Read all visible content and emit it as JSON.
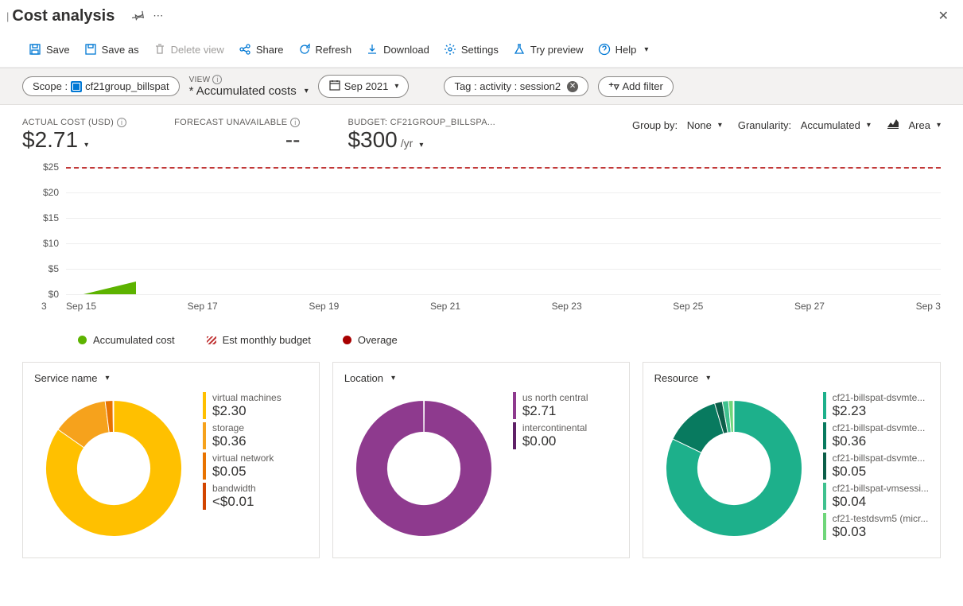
{
  "header": {
    "title": "Cost analysis"
  },
  "toolbar": {
    "save": "Save",
    "save_as": "Save as",
    "delete_view": "Delete view",
    "share": "Share",
    "refresh": "Refresh",
    "download": "Download",
    "settings": "Settings",
    "try_preview": "Try preview",
    "help": "Help"
  },
  "filters": {
    "scope_label": "Scope :",
    "scope_value": "cf21group_billspat",
    "view_label": "VIEW",
    "view_value": "* Accumulated costs",
    "date_value": "Sep 2021",
    "tag_label": "Tag : activity : session2",
    "add_filter": "Add filter"
  },
  "kpis": {
    "actual_label": "ACTUAL COST (USD)",
    "actual_value": "$2.71",
    "forecast_label": "FORECAST UNAVAILABLE",
    "forecast_value": "--",
    "budget_label": "BUDGET: CF21GROUP_BILLSPA...",
    "budget_value": "$300",
    "budget_suffix": "/yr"
  },
  "controls": {
    "group_by_label": "Group by:",
    "group_by_value": "None",
    "granularity_label": "Granularity:",
    "granularity_value": "Accumulated",
    "chart_type": "Area"
  },
  "chart_data": {
    "type": "area",
    "title": "",
    "ylabel": "",
    "xlabel": "",
    "y_ticks": [
      "$0",
      "$5",
      "$10",
      "$15",
      "$20",
      "$25"
    ],
    "ylim": [
      0,
      25
    ],
    "x_left": "3",
    "x_ticks": [
      "Sep 15",
      "Sep 17",
      "Sep 19",
      "Sep 21",
      "Sep 23",
      "Sep 25",
      "Sep 27",
      "Sep 3"
    ],
    "budget_line_value": 25,
    "series": [
      {
        "name": "Accumulated cost",
        "color": "#5db300",
        "x": [
          13,
          15
        ],
        "y": [
          0,
          2.7
        ]
      }
    ],
    "legend": [
      {
        "name": "Accumulated cost",
        "color": "#5db300",
        "shape": "circle"
      },
      {
        "name": "Est monthly budget",
        "color": "#c23939",
        "shape": "stripe"
      },
      {
        "name": "Overage",
        "color": "#a80000",
        "shape": "circle"
      }
    ]
  },
  "cards": {
    "service": {
      "title": "Service name",
      "chart_data": {
        "type": "pie",
        "series": [
          {
            "name": "virtual machines",
            "value": 2.3,
            "display": "$2.30",
            "color": "#ffc000"
          },
          {
            "name": "storage",
            "value": 0.36,
            "display": "$0.36",
            "color": "#f6a21c"
          },
          {
            "name": "virtual network",
            "value": 0.05,
            "display": "$0.05",
            "color": "#e87300"
          },
          {
            "name": "bandwidth",
            "value": 0.005,
            "display": "<$0.01",
            "color": "#d24500"
          }
        ]
      }
    },
    "location": {
      "title": "Location",
      "chart_data": {
        "type": "pie",
        "series": [
          {
            "name": "us north central",
            "value": 2.71,
            "display": "$2.71",
            "color": "#8e3a8e"
          },
          {
            "name": "intercontinental",
            "value": 0.001,
            "display": "$0.00",
            "color": "#5f2167"
          }
        ]
      }
    },
    "resource": {
      "title": "Resource",
      "chart_data": {
        "type": "pie",
        "series": [
          {
            "name": "cf21-billspat-dsvmte...",
            "value": 2.23,
            "display": "$2.23",
            "color": "#1db08b"
          },
          {
            "name": "cf21-billspat-dsvmte...",
            "value": 0.36,
            "display": "$0.36",
            "color": "#087a5f"
          },
          {
            "name": "cf21-billspat-dsvmte...",
            "value": 0.05,
            "display": "$0.05",
            "color": "#0b5e49"
          },
          {
            "name": "cf21-billspat-vmsessi...",
            "value": 0.04,
            "display": "$0.04",
            "color": "#3fc18f"
          },
          {
            "name": "cf21-testdsvm5 (micr...",
            "value": 0.03,
            "display": "$0.03",
            "color": "#6fd67a"
          },
          {
            "name": "cf21-billspat-vmsessi...",
            "value": 0.005,
            "display": "",
            "color": "#9fe08a"
          }
        ]
      }
    }
  }
}
